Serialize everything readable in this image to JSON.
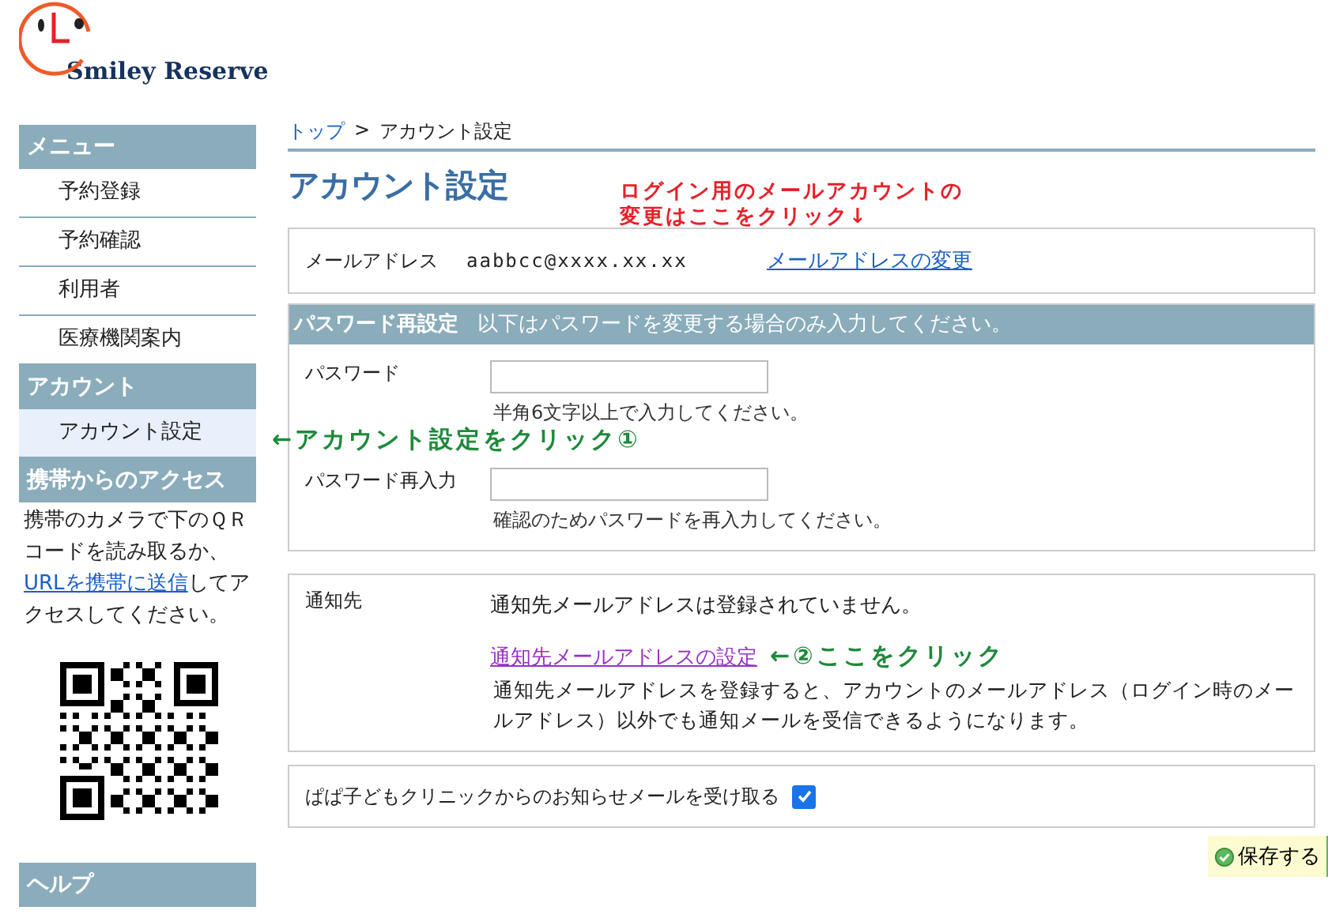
{
  "logo": {
    "text": "Smiley Reserve"
  },
  "sidebar": {
    "sections": [
      {
        "title": "メニュー",
        "items": [
          {
            "label": "予約登録",
            "selected": false
          },
          {
            "label": "予約確認",
            "selected": false
          },
          {
            "label": "利用者",
            "selected": false
          },
          {
            "label": "医療機関案内",
            "selected": false
          }
        ]
      },
      {
        "title": "アカウント",
        "items": [
          {
            "label": "アカウント設定",
            "selected": true
          }
        ]
      }
    ],
    "mobile": {
      "title": "携帯からのアクセス",
      "text_before": "携帯のカメラで下のＱＲコードを読み取るか、",
      "link": "URLを携帯に送信",
      "text_after": "してアクセスしてください。"
    },
    "help": {
      "title": "ヘルプ"
    }
  },
  "breadcrumb": {
    "items": [
      {
        "label": "トップ",
        "link": true
      },
      {
        "label": "アカウント設定",
        "link": false
      }
    ],
    "separator": ">"
  },
  "title": "アカウント設定",
  "title_annotation": {
    "lines": [
      "ログイン用のメールアカウントの",
      "変更はここをクリック↓"
    ],
    "color": "#e8202a"
  },
  "email": {
    "label": "メールアドレス",
    "value": "aabbcc@xxxx.xx.xx",
    "link": "メールアドレスの変更"
  },
  "password": {
    "title": "パスワード再設定",
    "note": "以下はパスワードを変更する場合のみ入力してください。",
    "fields": [
      {
        "label": "パスワード",
        "hint": "半角6文字以上で入力してください。"
      },
      {
        "label": "パスワード再入力",
        "hint": "確認のためパスワードを再入力してください。"
      }
    ],
    "annotation": {
      "text": "←アカウント設定をクリック①",
      "color": "#1e8a3a"
    }
  },
  "notify": {
    "label": "通知先",
    "status": "通知先メールアドレスは登録されていません。",
    "link": "通知先メールアドレスの設定",
    "annotation": {
      "text": "←②ここをクリック",
      "color": "#1e8a3a"
    },
    "description": "通知先メールアドレスを登録すると、アカウントのメールアドレス（ログイン時のメールアドレス）以外でも通知メールを受信できるようになります。"
  },
  "subscribe": {
    "label": "ぱぱ子どもクリニックからのお知らせメールを受け取る",
    "checked": true
  },
  "save_button": "保存する"
}
